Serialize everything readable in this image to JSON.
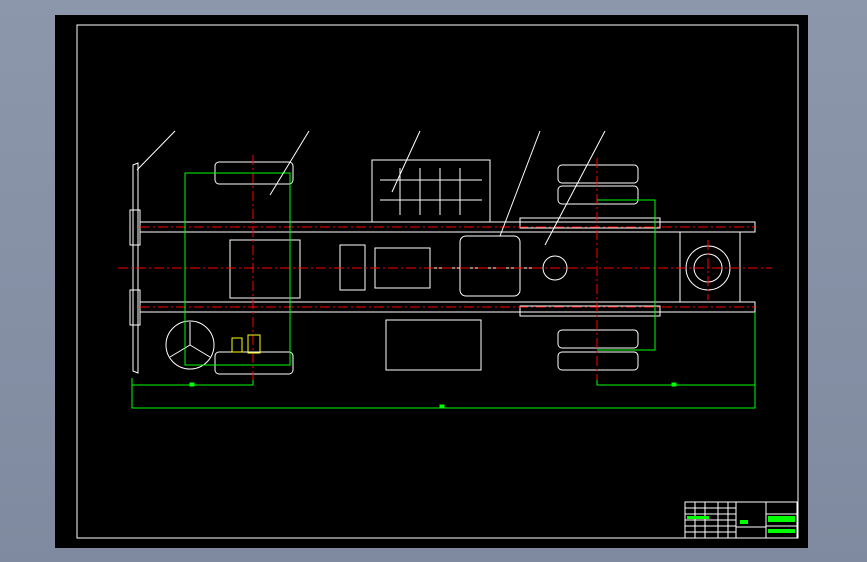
{
  "drawing": {
    "type": "vehicle chassis layout, top view",
    "colors": {
      "background": "#000000",
      "outline": "#ffffff",
      "centerline": "#ff0000",
      "dimension": "#00ff00",
      "highlight": "#ffff00",
      "viewport": "#8d97ab"
    },
    "callouts": [
      "",
      "",
      "",
      "",
      ""
    ],
    "title_block": {
      "title": "",
      "subtitle": ""
    }
  }
}
